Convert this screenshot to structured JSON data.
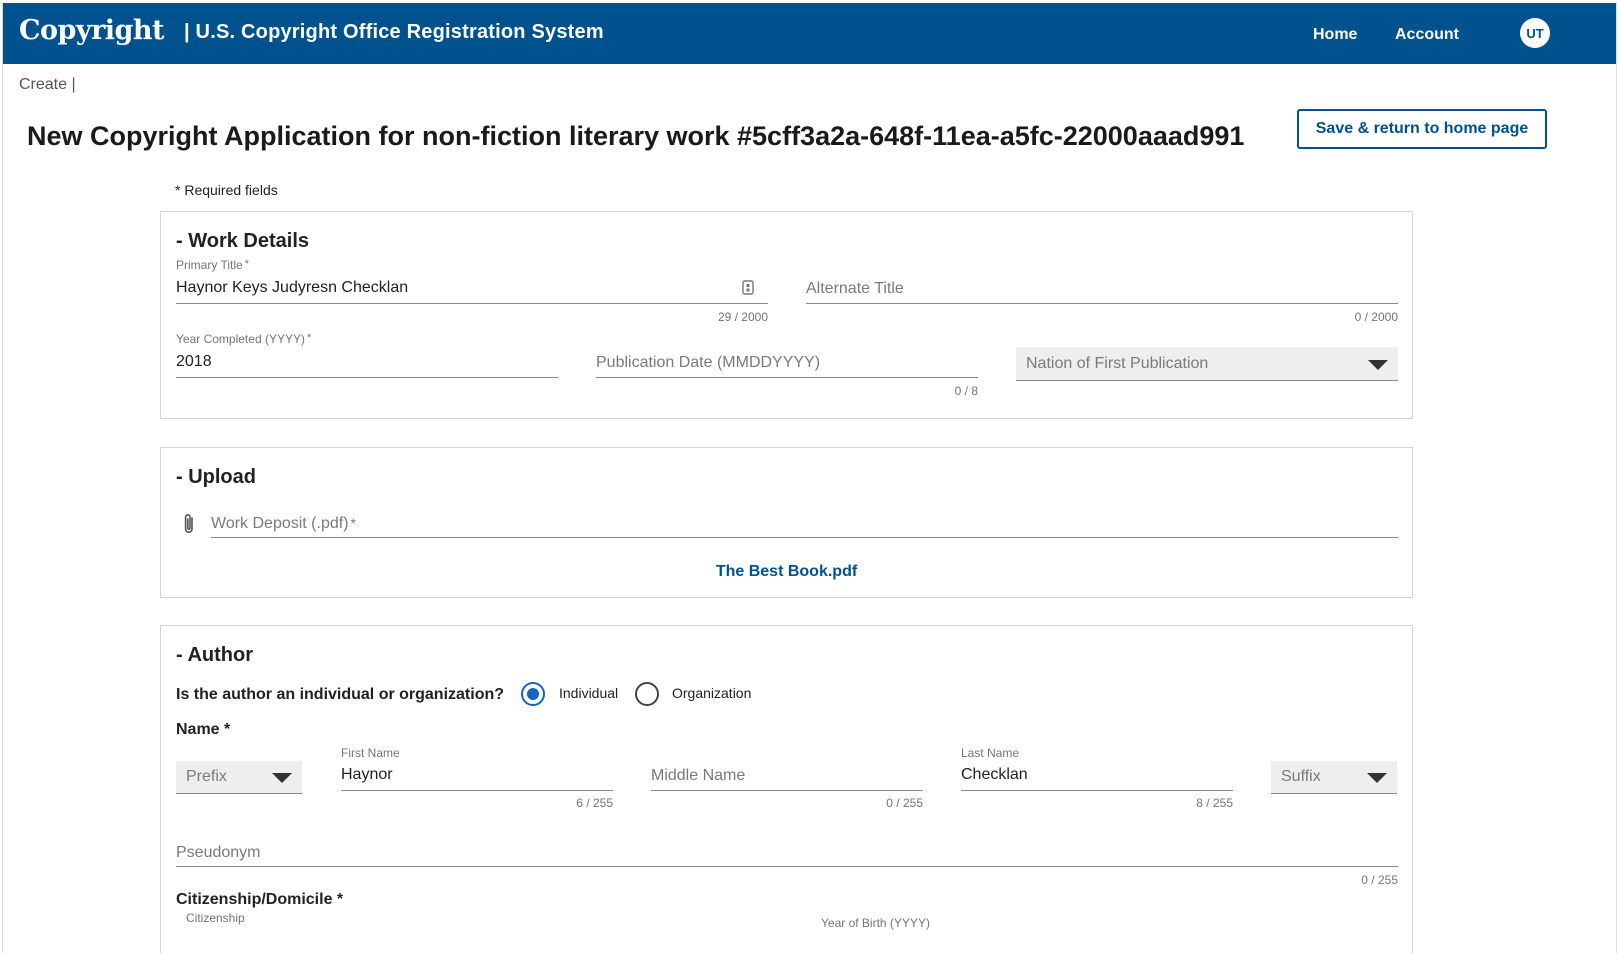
{
  "header": {
    "logo_text": "Copyright",
    "system_title": "| U.S. Copyright Office Registration System",
    "nav": {
      "home": "Home",
      "account": "Account"
    },
    "avatar_initials": "UT",
    "brand_color": "#00528f"
  },
  "breadcrumb": "Create |",
  "page": {
    "title": "New Copyright Application for non-fiction literary work #5cff3a2a-648f-11ea-a5fc-22000aaad991",
    "save_button": "Save & return to home page",
    "required_note": "* Required fields"
  },
  "work_details": {
    "heading": "- Work Details",
    "primary_title": {
      "label": "Primary Title",
      "required": "*",
      "value": "Haynor Keys Judyresn Checklan",
      "counter": "29 / 2000"
    },
    "alternate_title": {
      "placeholder": "Alternate Title",
      "counter": "0 / 2000"
    },
    "year_completed": {
      "label": "Year Completed (YYYY)",
      "required": "*",
      "value": "2018"
    },
    "publication_date": {
      "placeholder": "Publication Date (MMDDYYYY)",
      "counter": "0 / 8"
    },
    "nation_of_publication": {
      "placeholder": "Nation of First Publication"
    }
  },
  "upload": {
    "heading": "- Upload",
    "work_deposit": {
      "placeholder": "Work Deposit (.pdf)",
      "required": "*"
    },
    "file_name": "The Best Book.pdf"
  },
  "author": {
    "heading": "- Author",
    "question": "Is the author an individual or organization?",
    "options": {
      "individual": "Individual",
      "organization": "Organization"
    },
    "selected": "individual",
    "name_heading": "Name *",
    "prefix": {
      "placeholder": "Prefix"
    },
    "first_name": {
      "label": "First Name",
      "value": "Haynor",
      "counter": "6 / 255"
    },
    "middle_name": {
      "placeholder": "Middle Name",
      "counter": "0 / 255"
    },
    "last_name": {
      "label": "Last Name",
      "value": "Checklan",
      "counter": "8 / 255"
    },
    "suffix": {
      "placeholder": "Suffix"
    },
    "pseudonym": {
      "placeholder": "Pseudonym",
      "counter": "0 / 255"
    },
    "citizenship_heading": "Citizenship/Domicile *",
    "citizenship_label": "Citizenship",
    "year_of_birth_label": "Year of Birth (YYYY)"
  }
}
